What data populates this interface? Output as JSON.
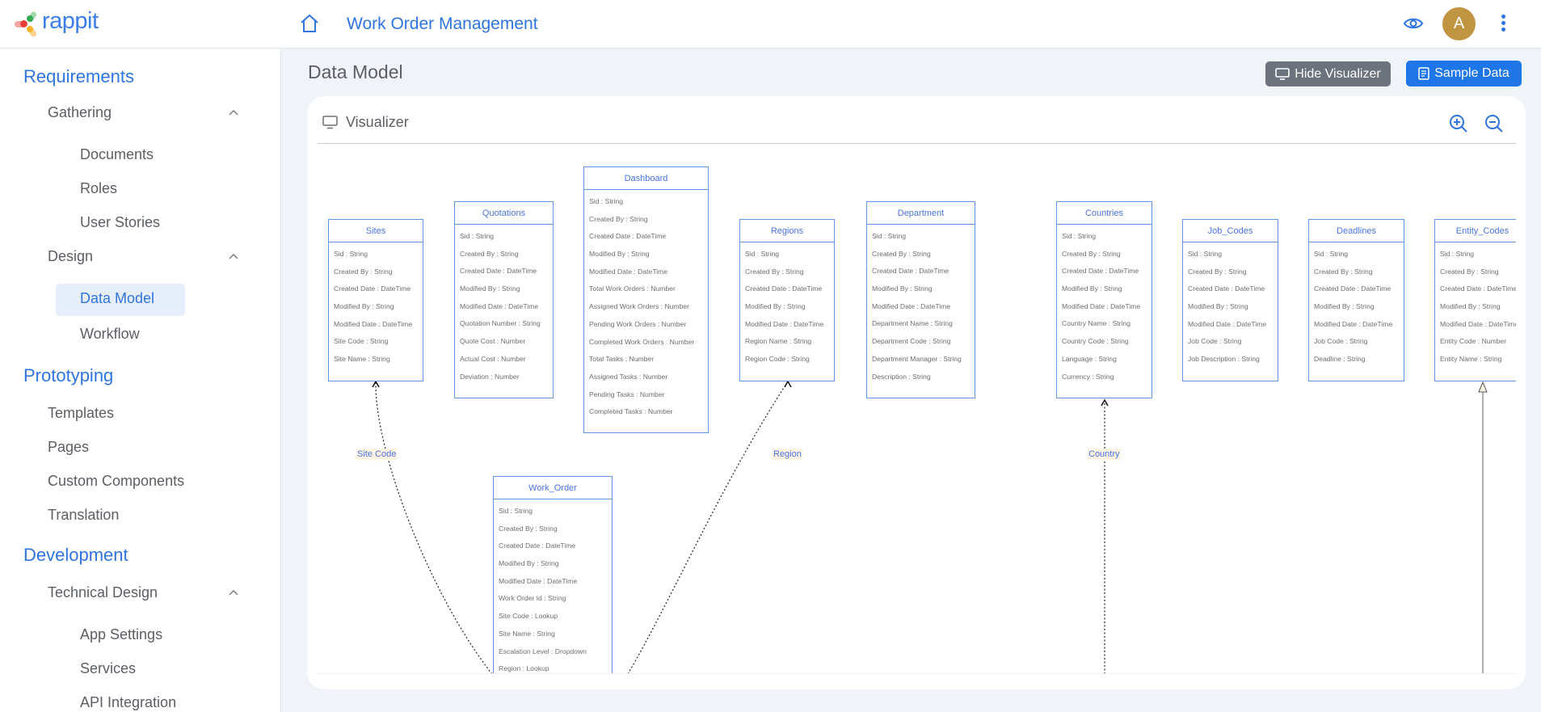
{
  "header": {
    "logo_text": "rappit",
    "app_title": "Work Order Management",
    "avatar_initial": "A",
    "icons": {
      "home": "home-icon",
      "preview": "eye-icon",
      "more": "more-vertical-icon"
    },
    "colors": {
      "accent": "#2f74df",
      "avatar_bg": "#c09441"
    }
  },
  "sidebar": {
    "sections": [
      {
        "label": "Requirements"
      },
      {
        "label": "Prototyping"
      },
      {
        "label": "Development"
      }
    ],
    "groups": [
      {
        "label": "Gathering",
        "expanded": true
      },
      {
        "label": "Design",
        "expanded": true
      },
      {
        "label": "Technical Design",
        "expanded": true
      }
    ],
    "items": [
      {
        "label": "Documents"
      },
      {
        "label": "Roles"
      },
      {
        "label": "User Stories"
      },
      {
        "label": "Data Model",
        "active": true
      },
      {
        "label": "Workflow"
      },
      {
        "label": "Templates"
      },
      {
        "label": "Pages"
      },
      {
        "label": "Custom Components"
      },
      {
        "label": "Translation"
      },
      {
        "label": "App Settings"
      },
      {
        "label": "Services"
      },
      {
        "label": "API Integration"
      }
    ]
  },
  "main": {
    "page_title": "Data Model",
    "buttons": {
      "hide_visualizer": "Hide Visualizer",
      "sample_data": "Sample Data"
    },
    "visualizer": {
      "label": "Visualizer",
      "zoom_in": "zoom-in-icon",
      "zoom_out": "zoom-out-icon"
    }
  },
  "entities": [
    {
      "name": "Sites",
      "fields": [
        "Sid : String",
        "Created By : String",
        "Created Date : DateTime",
        "Modified By : String",
        "Modified Date : DateTime",
        "Site Code : String",
        "Site Name : String"
      ]
    },
    {
      "name": "Quotations",
      "fields": [
        "Sid : String",
        "Created By : String",
        "Created Date : DateTime",
        "Modified By : String",
        "Modified Date : DateTime",
        "Quotation Number : String",
        "Quote Cost : Number",
        "Actual Cost : Number",
        "Deviation : Number"
      ]
    },
    {
      "name": "Dashboard",
      "fields": [
        "Sid : String",
        "Created By : String",
        "Created Date : DateTime",
        "Modified By : String",
        "Modified Date : DateTime",
        "Total Work Orders : Number",
        "Assigned Work Orders : Number",
        "Pending Work Orders : Number",
        "Completed Work Orders : Number",
        "Total Tasks : Number",
        "Assigned Tasks : Number",
        "Pending Tasks : Number",
        "Completed Tasks : Number"
      ]
    },
    {
      "name": "Regions",
      "fields": [
        "Sid : String",
        "Created By : String",
        "Created Date : DateTime",
        "Modified By : String",
        "Modified Date : DateTime",
        "Region Name : String",
        "Region Code : String"
      ]
    },
    {
      "name": "Department",
      "fields": [
        "Sid : String",
        "Created By : String",
        "Created Date : DateTime",
        "Modified By : String",
        "Modified Date : DateTime",
        "Department Name : String",
        "Department Code : String",
        "Department Manager : String",
        "Description : String"
      ]
    },
    {
      "name": "Countries",
      "fields": [
        "Sid : String",
        "Created By : String",
        "Created Date : DateTime",
        "Modified By : String",
        "Modified Date : DateTime",
        "Country Name : String",
        "Country Code : String",
        "Language : String",
        "Currency : String"
      ]
    },
    {
      "name": "Job_Codes",
      "fields": [
        "Sid : String",
        "Created By : String",
        "Created Date : DateTime",
        "Modified By : String",
        "Modified Date : DateTime",
        "Job Code : String",
        "Job Description : String"
      ]
    },
    {
      "name": "Deadlines",
      "fields": [
        "Sid : String",
        "Created By : String",
        "Created Date : DateTime",
        "Modified By : String",
        "Modified Date : DateTime",
        "Job Code : String",
        "Deadline : String"
      ]
    },
    {
      "name": "Entity_Codes",
      "fields": [
        "Sid : String",
        "Created By : String",
        "Created Date : DateTime",
        "Modified By : String",
        "Modified Date : DateTime",
        "Entity Code : Number",
        "Entity Name : String"
      ]
    },
    {
      "name": "Work_Order",
      "fields": [
        "Sid : String",
        "Created By : String",
        "Created Date : DateTime",
        "Modified By : String",
        "Modified Date : DateTime",
        "Work Order Id : String",
        "Site Code : Lookup",
        "Site Name : String",
        "Escalation Level : Dropdown",
        "Region : Lookup"
      ]
    }
  ],
  "relationships": [
    {
      "label": "Site Code",
      "from": "Work_Order",
      "to": "Sites"
    },
    {
      "label": "Region",
      "from": "Work_Order",
      "to": "Regions"
    },
    {
      "label": "Country",
      "to": "Countries"
    },
    {
      "label": "",
      "to": "Entity_Codes"
    }
  ]
}
